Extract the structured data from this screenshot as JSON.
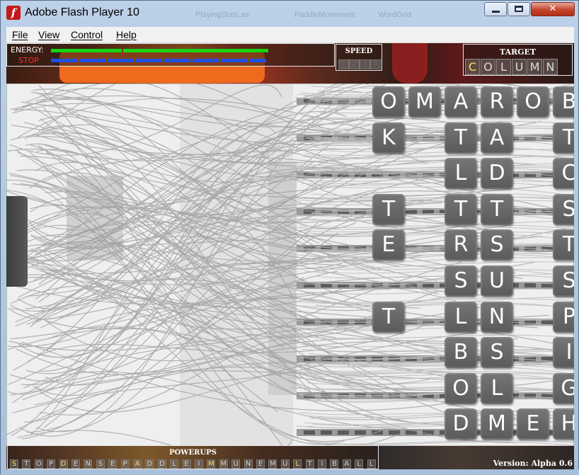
{
  "window": {
    "title": "Adobe Flash Player 10",
    "icon": "flash-f",
    "icon_glyph": "f"
  },
  "background_tabs": [
    "PlayingStats.as",
    "PaddleMovement",
    "WordGrid"
  ],
  "controls": {
    "minimize": "minimize",
    "maximize": "maximize",
    "close": "✕"
  },
  "menu": [
    "File",
    "View",
    "Control",
    "Help"
  ],
  "hud": {
    "energy_label": "ENERGY:",
    "stop_label": "STOP",
    "energy_color": "#14d414",
    "stop_bar_color": "#1e50e6",
    "speed_title": "SPEED",
    "speed_levels": [
      "1",
      "2",
      "3",
      "4"
    ],
    "target_title": "TARGET",
    "target_letters": [
      "C",
      "O",
      "L",
      "U",
      "M",
      "N"
    ],
    "target_hit_count": 1,
    "powerups_title": "POWERUPS",
    "powerups": [
      "S",
      "T",
      "O",
      "P",
      "D",
      "E",
      "N",
      "S",
      "E",
      "P",
      "A",
      "D",
      "D",
      "L",
      "E",
      "I",
      "M",
      "M",
      "U",
      "N",
      "E",
      "M",
      "U",
      "L",
      "T",
      "I",
      "B",
      "A",
      "L",
      "L"
    ],
    "powerups_highlight": [
      0,
      4,
      10,
      16,
      23
    ],
    "version": "Version: Alpha 0.6"
  },
  "grid": {
    "columns": 6,
    "rows": [
      [
        "O",
        "M",
        "A",
        "R",
        "O",
        "B"
      ],
      [
        "K",
        "",
        "T",
        "A",
        "",
        "T"
      ],
      [
        "",
        "",
        "L",
        "D",
        "",
        "C"
      ],
      [
        "T",
        "",
        "T",
        "T",
        "",
        "S"
      ],
      [
        "E",
        "",
        "R",
        "S",
        "",
        "T"
      ],
      [
        "",
        "",
        "S",
        "U",
        "",
        "S"
      ],
      [
        "T",
        "",
        "L",
        "N",
        "",
        "P"
      ],
      [
        "",
        "",
        "B",
        "S",
        "",
        "I"
      ],
      [
        "",
        "",
        "O",
        "L",
        "",
        "G"
      ],
      [
        "",
        "",
        "D",
        "M",
        "E",
        "H"
      ]
    ]
  }
}
